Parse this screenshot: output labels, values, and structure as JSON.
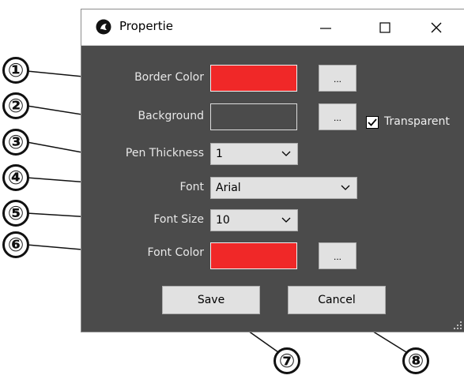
{
  "window": {
    "title": "Propertie",
    "controls": {
      "minimize": "—",
      "maximize": "☐",
      "close": "✕"
    }
  },
  "fields": {
    "border_color_label": "Border Color",
    "background_label": "Background",
    "transparent_label": "Transparent",
    "transparent_checked": true,
    "pen_thickness_label": "Pen Thickness",
    "pen_thickness_value": "1",
    "font_label": "Font",
    "font_value": "Arial",
    "font_size_label": "Font Size",
    "font_size_value": "10",
    "font_color_label": "Font Color",
    "picker_button_label": "..."
  },
  "colors": {
    "border_color": "#f02828",
    "font_color": "#f02828",
    "window_bg": "#4b4b4b"
  },
  "buttons": {
    "save": "Save",
    "cancel": "Cancel"
  },
  "callouts": [
    "①",
    "②",
    "③",
    "④",
    "⑤",
    "⑥",
    "⑦",
    "⑧"
  ]
}
